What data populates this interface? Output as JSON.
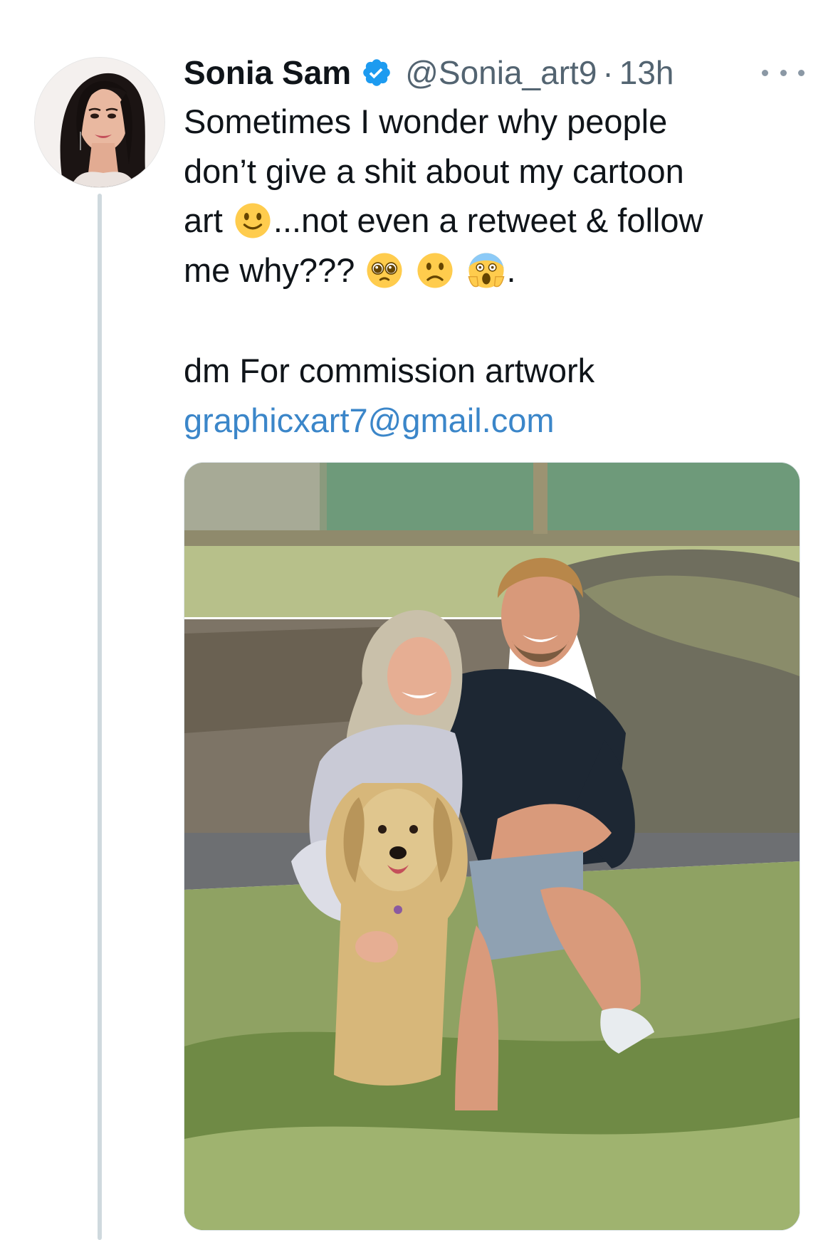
{
  "tweet": {
    "display_name": "Sonia Sam",
    "handle": "@Sonia_art9",
    "separator": "·",
    "timestamp": "13h",
    "verified": true,
    "text_lines": [
      "Sometimes I wonder why people",
      "don’t give a shit about my cartoon",
      "art",
      "...not even a retweet & follow",
      "me why???",
      "."
    ],
    "emojis": [
      "slightly-smiling-face",
      "pleading-face",
      "slightly-frowning-face",
      "face-screaming-in-fear"
    ],
    "commission_text": "dm For commission artwork",
    "email": "graphicxart7@gmail.com"
  },
  "colors": {
    "link": "#3b86c9",
    "verified_badge": "#1d9bf0",
    "secondary_text": "#536471",
    "thread_line": "#cfd9de"
  }
}
